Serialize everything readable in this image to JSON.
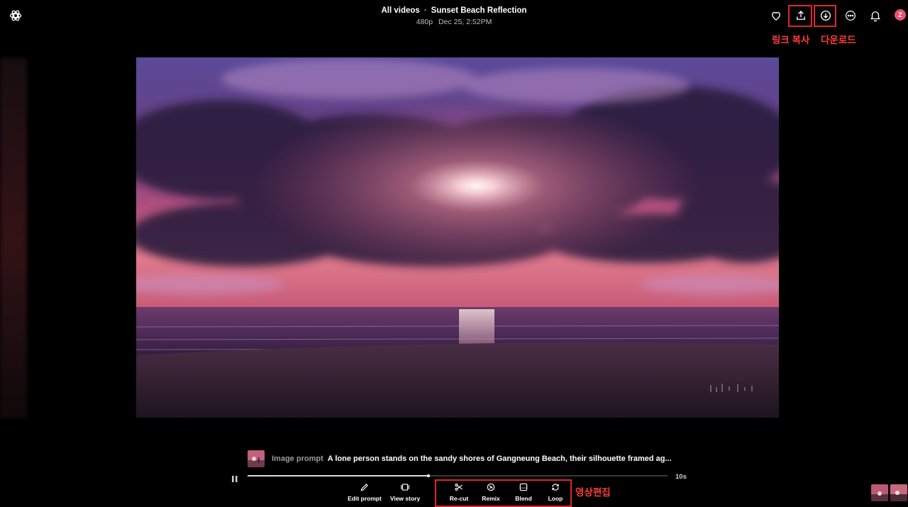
{
  "header": {
    "breadcrumb_root": "All videos",
    "separator": "·",
    "video_title": "Sunset Beach Reflection",
    "resolution": "480p",
    "date": "Dec 25, 2:52PM"
  },
  "top_actions": {
    "favorite_icon": "heart-icon",
    "share_icon": "upload-icon",
    "download_icon": "download-icon",
    "more_icon": "more-icon",
    "notifications_icon": "bell-icon",
    "avatar_initial": "Z"
  },
  "annotations": {
    "copy_link": "링크 복사",
    "download": "다운로드",
    "video_edit": "영상편집"
  },
  "prompt": {
    "label": "Image prompt",
    "text": "A lone person stands on the sandy shores of Gangneung Beach, their silhouette framed ag..."
  },
  "player": {
    "duration": "10s",
    "progress": 0.43
  },
  "tools": {
    "edit_prompt": "Edit prompt",
    "view_story": "View story",
    "recut": "Re-cut",
    "remix": "Remix",
    "blend": "Blend",
    "loop": "Loop"
  },
  "colors": {
    "annotation_red": "#e0262c",
    "avatar": "#e8516d"
  }
}
